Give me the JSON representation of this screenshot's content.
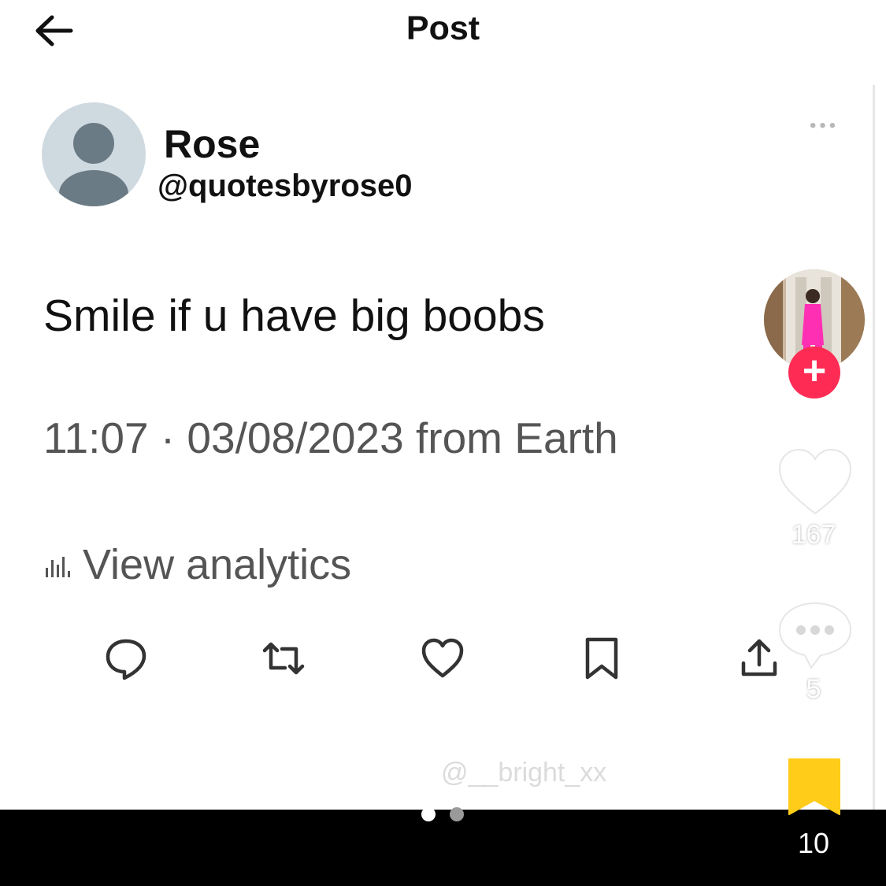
{
  "header": {
    "title": "Post",
    "back_icon": "back-arrow-icon"
  },
  "author": {
    "name": "Rose",
    "handle": "@quotesbyrose0",
    "avatar": "default-avatar-icon"
  },
  "post": {
    "text": "Smile if u have big boobs",
    "meta": "11:07 · 03/08/2023 from Earth",
    "analytics_label": "View analytics"
  },
  "actions": [
    "reply-icon",
    "repost-icon",
    "like-icon",
    "bookmark-icon",
    "share-icon"
  ],
  "sidebar": {
    "like_count": "167",
    "comment_count": "5",
    "bookmark_count": "10"
  },
  "watermark": "@__bright_xx",
  "colors": {
    "follow": "#fe2c55",
    "bookmark": "#ffcc1a",
    "meta_text": "#555555"
  }
}
